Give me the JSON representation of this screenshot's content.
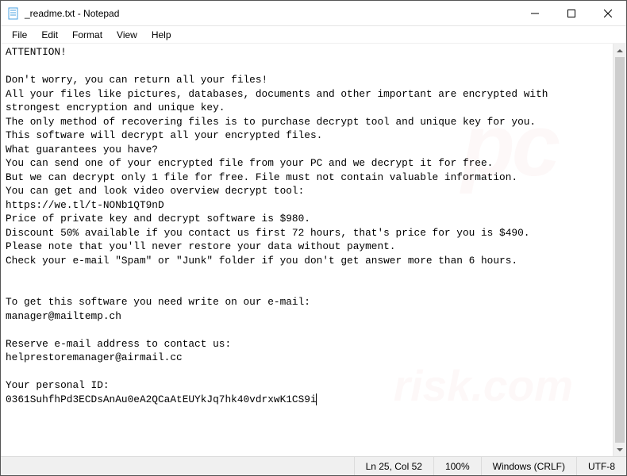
{
  "window": {
    "title": "_readme.txt - Notepad"
  },
  "menu": {
    "file": "File",
    "edit": "Edit",
    "format": "Format",
    "view": "View",
    "help": "Help"
  },
  "content": {
    "text": "ATTENTION!\n\nDon't worry, you can return all your files!\nAll your files like pictures, databases, documents and other important are encrypted with strongest encryption and unique key.\nThe only method of recovering files is to purchase decrypt tool and unique key for you.\nThis software will decrypt all your encrypted files.\nWhat guarantees you have?\nYou can send one of your encrypted file from your PC and we decrypt it for free.\nBut we can decrypt only 1 file for free. File must not contain valuable information.\nYou can get and look video overview decrypt tool:\nhttps://we.tl/t-NONb1QT9nD\nPrice of private key and decrypt software is $980.\nDiscount 50% available if you contact us first 72 hours, that's price for you is $490.\nPlease note that you'll never restore your data without payment.\nCheck your e-mail \"Spam\" or \"Junk\" folder if you don't get answer more than 6 hours.\n\n\nTo get this software you need write on our e-mail:\nmanager@mailtemp.ch\n\nReserve e-mail address to contact us:\nhelprestoremanager@airmail.cc\n\nYour personal ID:\n0361SuhfhPd3ECDsAnAu0eA2QCaAtEUYkJq7hk40vdrxwK1CS9i"
  },
  "status": {
    "position": "Ln 25, Col 52",
    "zoom": "100%",
    "line_ending": "Windows (CRLF)",
    "encoding": "UTF-8"
  }
}
